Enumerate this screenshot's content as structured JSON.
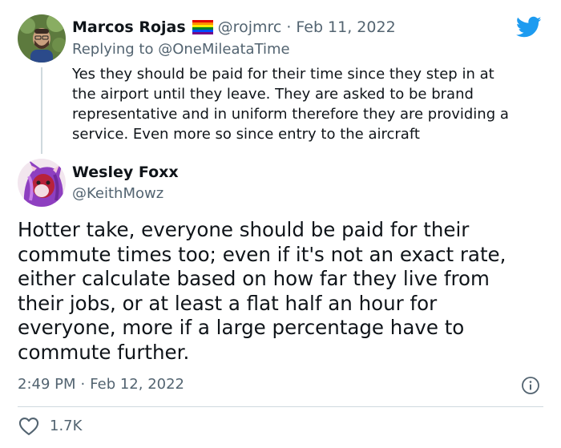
{
  "reply_tweet": {
    "author_name": "Marcos Rojas",
    "author_handle": "@rojmrc",
    "separator": "·",
    "date": "Feb 11, 2022",
    "replying_to_prefix": "Replying to ",
    "replying_to_handle": "@OneMileataTime",
    "text": "Yes they should be paid for their time since they step in at\nthe airport until they leave. They are asked to be brand\nrepresentative and in uniform therefore they are providing a\nservice. Even more so since entry to the aircraft",
    "flag_icon": "rainbow-flag-icon"
  },
  "main_tweet": {
    "author_name": "Wesley Foxx",
    "author_handle": "@KeithMowz",
    "text": "Hotter take, everyone should be paid for their\ncommute times too; even if it's not an exact rate,\neither calculate based on how far they live from\ntheir jobs, or at least a flat half an hour for\neveryone, more if a large percentage have to\ncommute further.",
    "time": "2:49 PM",
    "separator": "·",
    "date": "Feb 12, 2022",
    "like_count": "1.7K"
  },
  "colors": {
    "twitter_blue": "#1d9bf0",
    "text_primary": "#0f1419",
    "text_secondary": "#536471",
    "divider": "#cfd9de"
  },
  "icons": [
    "twitter-bird-icon",
    "rainbow-flag-icon",
    "info-icon",
    "heart-icon"
  ]
}
